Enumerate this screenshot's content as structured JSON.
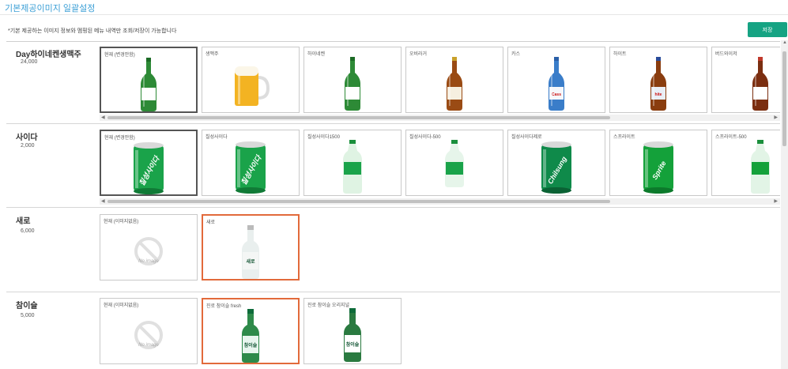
{
  "page": {
    "title": "기본제공이미지 일괄설정",
    "notice": "*기본 제공하는 이미지 정보와 멤핑된 메뉴 내역만 조회/저장이 가능합니다",
    "save_label": "저장"
  },
  "colors": {
    "accent": "#16a383",
    "title": "#3b9fd6",
    "current_border": "#555555",
    "selected_border": "#e26a3b"
  },
  "no_image_text": "No image",
  "rows": [
    {
      "name": "Day하이네켄생맥주",
      "price": "24,000",
      "scroll_progress": 0.7,
      "cards": [
        {
          "label": "현재 (변경안함)",
          "icon": "heineken-bottle-icon",
          "state": "current"
        },
        {
          "label": "생맥주",
          "icon": "beer-mug-icon",
          "state": ""
        },
        {
          "label": "하이네켄",
          "icon": "heineken-bottle-icon",
          "state": ""
        },
        {
          "label": "오비라거",
          "icon": "ob-lager-bottle-icon",
          "state": ""
        },
        {
          "label": "카스",
          "icon": "cass-bottle-icon",
          "state": ""
        },
        {
          "label": "하이트",
          "icon": "hite-bottle-icon",
          "state": ""
        },
        {
          "label": "버드와이저",
          "icon": "budweiser-bottle-icon",
          "state": ""
        }
      ]
    },
    {
      "name": "사이다",
      "price": "2,000",
      "scroll_progress": 0.72,
      "cards": [
        {
          "label": "현재 (변경안함)",
          "icon": "chilsung-can-icon",
          "state": "current"
        },
        {
          "label": "칠성사이다",
          "icon": "chilsung-can-icon",
          "state": ""
        },
        {
          "label": "칠성사이다1500",
          "icon": "chilsung-pet-icon",
          "state": ""
        },
        {
          "label": "칠성사이다-500",
          "icon": "chilsung-pet-small-icon",
          "state": ""
        },
        {
          "label": "칠성사이다제로",
          "icon": "chilsung-zero-can-icon",
          "state": ""
        },
        {
          "label": "스프라이트",
          "icon": "sprite-can-icon",
          "state": ""
        },
        {
          "label": "스프라이트-500",
          "icon": "sprite-bottle-icon",
          "state": ""
        }
      ]
    },
    {
      "name": "새로",
      "price": "6,000",
      "cards": [
        {
          "label": "현재 (이미지없음)",
          "icon": "no-image-icon",
          "state": ""
        },
        {
          "label": "새로",
          "icon": "saero-bottle-icon",
          "state": "selected"
        }
      ]
    },
    {
      "name": "참이슬",
      "price": "5,000",
      "cards": [
        {
          "label": "현재 (이미지없음)",
          "icon": "no-image-icon",
          "state": ""
        },
        {
          "label": "진로 참이슬 fresh",
          "icon": "chamisul-fresh-bottle-icon",
          "state": "selected"
        },
        {
          "label": "진로 참이슬 오리지널",
          "icon": "chamisul-original-bottle-icon",
          "state": ""
        }
      ]
    }
  ]
}
